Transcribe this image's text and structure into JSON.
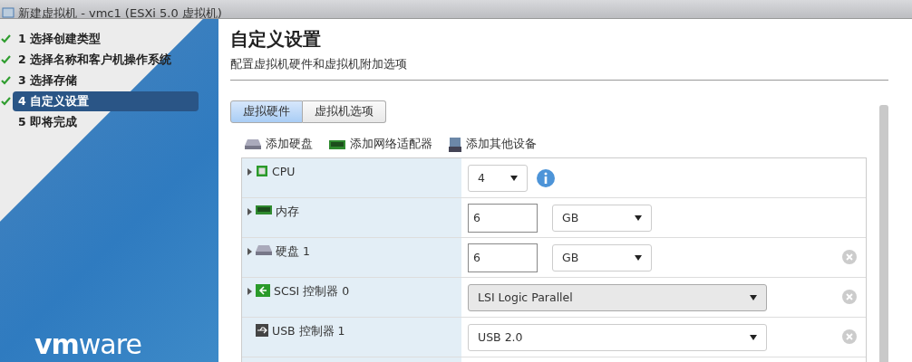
{
  "window": {
    "title": "新建虚拟机 - vmc1 (ESXi 5.0 虚拟机)"
  },
  "steps": [
    {
      "label": "1 选择创建类型",
      "checked": true,
      "selected": false
    },
    {
      "label": "2 选择名称和客户机操作系统",
      "checked": true,
      "selected": false
    },
    {
      "label": "3 选择存储",
      "checked": true,
      "selected": false
    },
    {
      "label": "4 自定义设置",
      "checked": true,
      "selected": true
    },
    {
      "label": "5 即将完成",
      "checked": false,
      "selected": false
    }
  ],
  "logo": "**vm**ware",
  "page": {
    "title": "自定义设置",
    "subtitle": "配置虚拟机硬件和虚拟机附加选项"
  },
  "tabs": [
    {
      "label": "虚拟硬件",
      "selected": true
    },
    {
      "label": "虚拟机选项",
      "selected": false
    }
  ],
  "toolbar": [
    {
      "label": "添加硬盘"
    },
    {
      "label": "添加网络适配器"
    },
    {
      "label": "添加其他设备"
    }
  ],
  "hardware": [
    {
      "label": "CPU",
      "expandable": true,
      "removable": false,
      "kind": "select",
      "value": "4",
      "info": true
    },
    {
      "label": "内存",
      "expandable": true,
      "removable": false,
      "kind": "size",
      "value": "6",
      "unit": "GB"
    },
    {
      "label": "硬盘 1",
      "expandable": true,
      "removable": true,
      "kind": "size",
      "value": "6",
      "unit": "GB"
    },
    {
      "label": "SCSI 控制器 0",
      "expandable": true,
      "removable": true,
      "kind": "wide_select",
      "value": "LSI Logic Parallel",
      "disabled": true
    },
    {
      "label": "USB 控制器 1",
      "expandable": false,
      "removable": true,
      "kind": "wide_select",
      "value": "USB 2.0",
      "disabled": false
    }
  ]
}
